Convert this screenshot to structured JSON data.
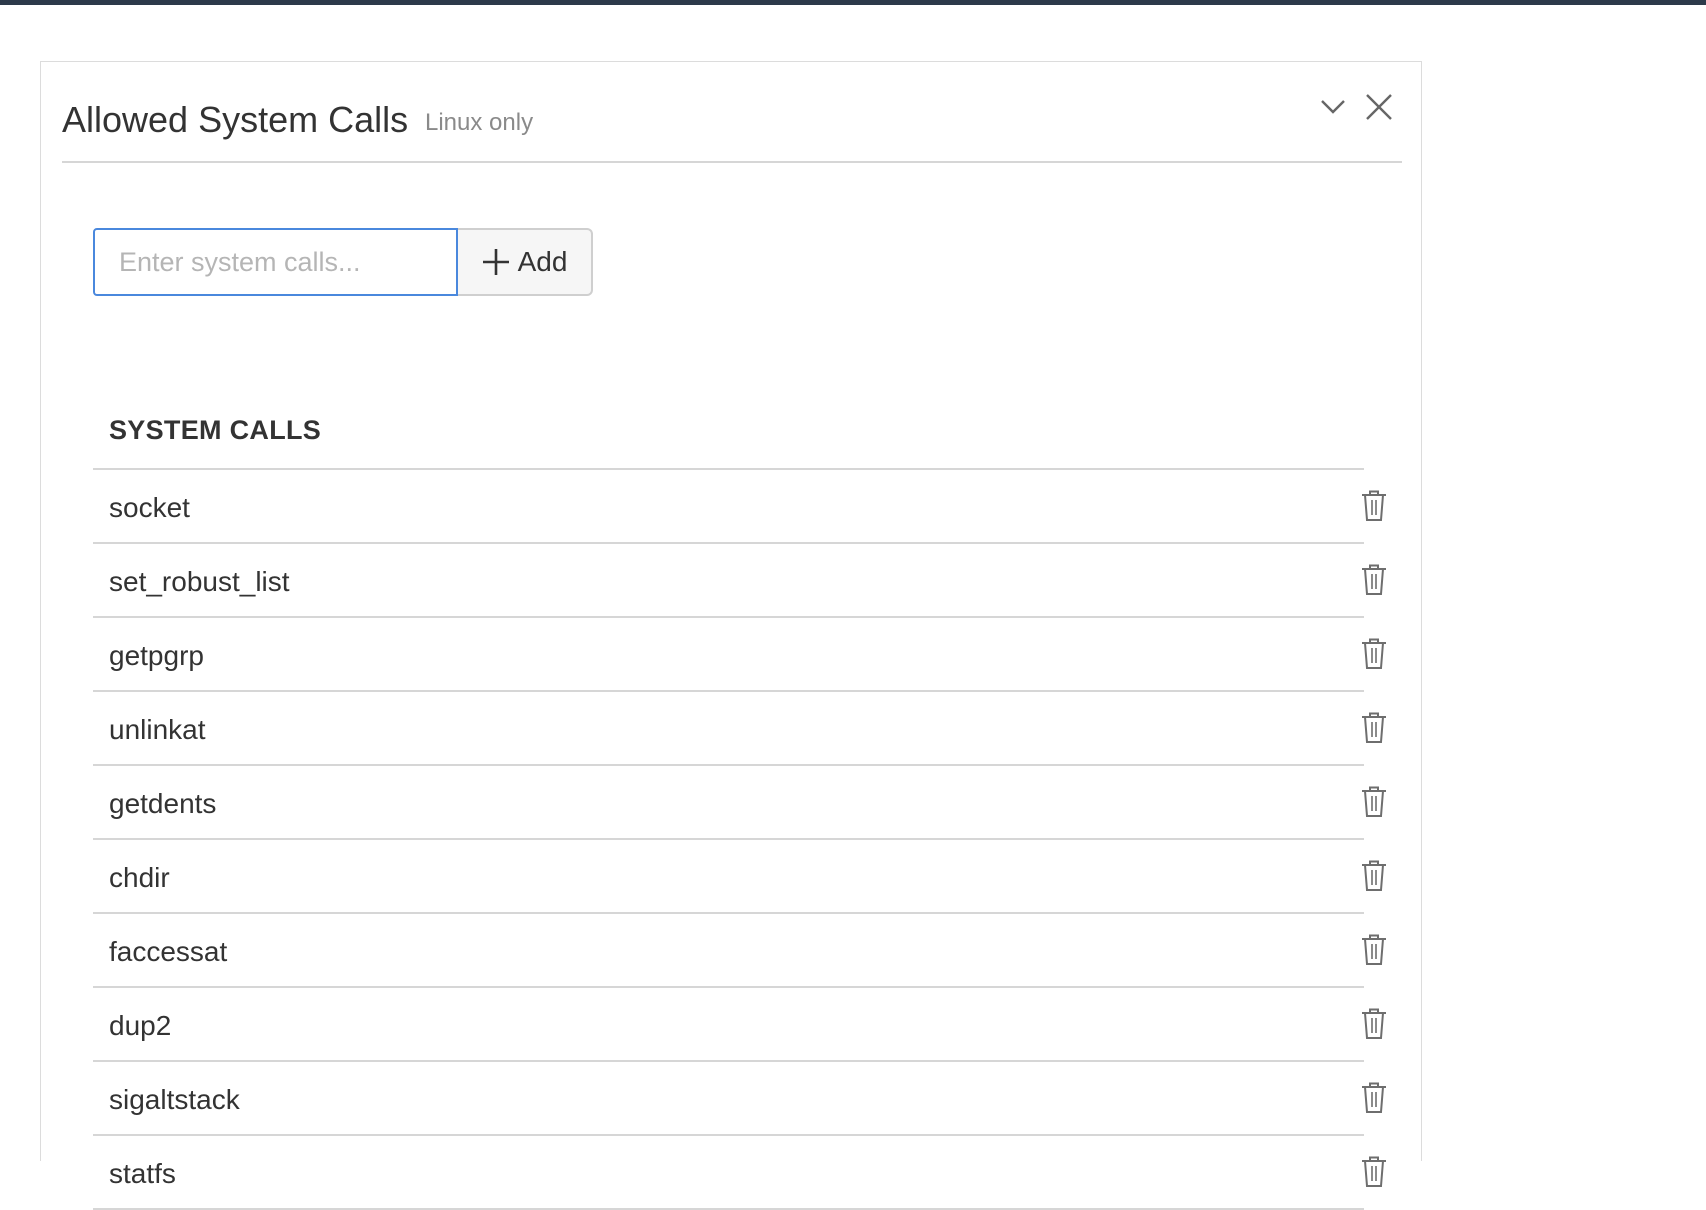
{
  "panel": {
    "title": "Allowed System Calls",
    "subtitle": "Linux only",
    "collapse_icon": "chevron-down-icon",
    "close_icon": "close-icon"
  },
  "add_form": {
    "placeholder": "Enter system calls...",
    "value": "",
    "add_label": "Add",
    "add_icon": "plus-icon"
  },
  "table": {
    "header": "SYSTEM CALLS",
    "delete_icon": "trash-icon",
    "rows": [
      {
        "name": "socket"
      },
      {
        "name": "set_robust_list"
      },
      {
        "name": "getpgrp"
      },
      {
        "name": "unlinkat"
      },
      {
        "name": "getdents"
      },
      {
        "name": "chdir"
      },
      {
        "name": "faccessat"
      },
      {
        "name": "dup2"
      },
      {
        "name": "sigaltstack"
      },
      {
        "name": "statfs"
      }
    ]
  },
  "colors": {
    "top_bar": "#2d3a4a",
    "input_focus_border": "#4a88dd",
    "divider": "#d6d6d6",
    "muted_text": "#8a8a8a"
  }
}
